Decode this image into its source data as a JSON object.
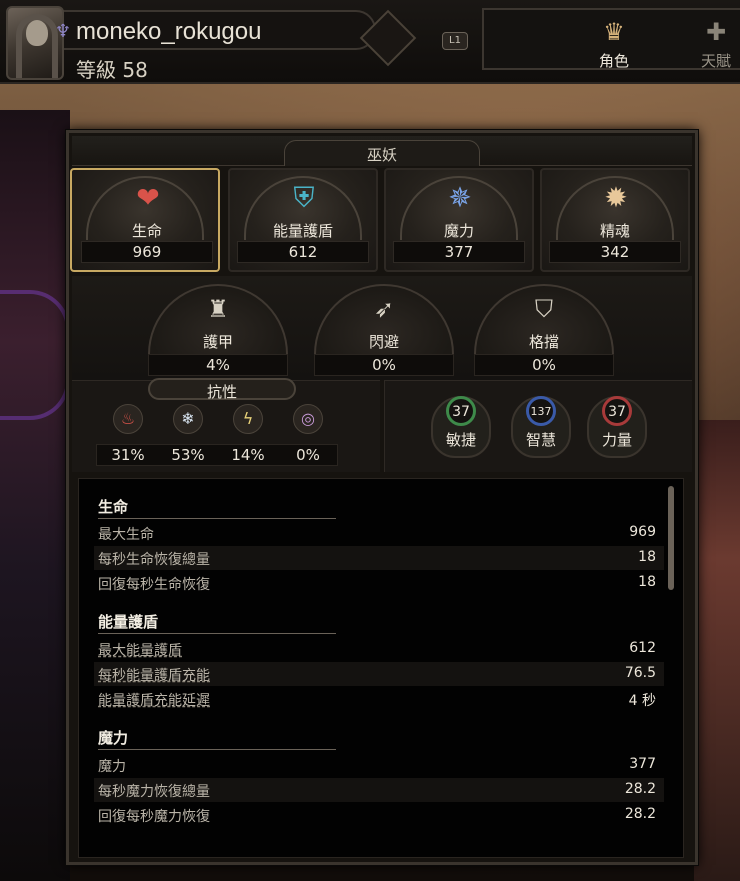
{
  "player": {
    "username": "moneko_rokugou",
    "level": "等級 58"
  },
  "header": {
    "l1_badge": "L1",
    "tabs": [
      {
        "label": "角色",
        "icon": "character-icon",
        "active": true
      },
      {
        "label": "天賦",
        "icon": "talent-icon",
        "active": false
      }
    ]
  },
  "panel": {
    "title": "巫妖"
  },
  "main_stats": [
    {
      "label": "生命",
      "value": "969",
      "icon": "heart-icon",
      "selected": true
    },
    {
      "label": "能量護盾",
      "value": "612",
      "icon": "energy-shield-icon",
      "selected": false
    },
    {
      "label": "魔力",
      "value": "377",
      "icon": "mana-icon",
      "selected": false
    },
    {
      "label": "精魂",
      "value": "342",
      "icon": "spirit-icon",
      "selected": false
    }
  ],
  "defenses": [
    {
      "label": "護甲",
      "value": "4%",
      "icon": "armour-icon"
    },
    {
      "label": "閃避",
      "value": "0%",
      "icon": "evasion-icon"
    },
    {
      "label": "格擋",
      "value": "0%",
      "icon": "block-icon"
    }
  ],
  "resistances": {
    "title": "抗性",
    "items": [
      {
        "type": "fire",
        "value": "31%",
        "icon": "fire-icon",
        "color": "#d9534a"
      },
      {
        "type": "cold",
        "value": "53%",
        "icon": "cold-icon",
        "color": "#d8e4f0"
      },
      {
        "type": "lightning",
        "value": "14%",
        "icon": "lightning-icon",
        "color": "#e8d27a"
      },
      {
        "type": "chaos",
        "value": "0%",
        "icon": "chaos-icon",
        "color": "#c89ad8"
      }
    ]
  },
  "attributes": [
    {
      "label": "敏捷",
      "value": "37",
      "color": "#3e8a4a"
    },
    {
      "label": "智慧",
      "value": "137",
      "color": "#3a5aa8"
    },
    {
      "label": "力量",
      "value": "37",
      "color": "#a83a3a"
    }
  ],
  "details": {
    "sections": [
      {
        "title": "生命",
        "rows": [
          {
            "label": "最大生命",
            "value": "969",
            "dashed": false
          },
          {
            "label": "每秒生命恢復總量",
            "value": "18",
            "dashed": false
          },
          {
            "label": "回復每秒生命恢復",
            "value": "18",
            "dashed": false
          }
        ]
      },
      {
        "title": "能量護盾",
        "rows": [
          {
            "label": "最大能量護盾",
            "value": "612",
            "dashed": true
          },
          {
            "label": "每秒能量護盾充能",
            "value": "76.5",
            "dashed": true
          },
          {
            "label": "能量護盾充能延遲",
            "value": "4 秒",
            "dashed": true
          }
        ]
      },
      {
        "title": "魔力",
        "rows": [
          {
            "label": "魔力",
            "value": "377",
            "dashed": false
          },
          {
            "label": "每秒魔力恢復總量",
            "value": "28.2",
            "dashed": false
          },
          {
            "label": "回復每秒魔力恢復",
            "value": "28.2",
            "dashed": false
          }
        ]
      }
    ]
  },
  "colors": {
    "selected_border": "#c8a962",
    "panel_bg": "#16130f",
    "detail_bg": "#020202"
  }
}
